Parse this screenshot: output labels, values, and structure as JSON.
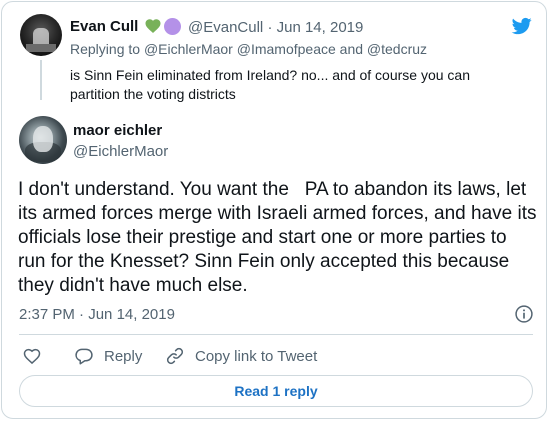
{
  "parent_tweet": {
    "name": "Evan Cull",
    "handle": "@EvanCull",
    "separator": "·",
    "date": "Jun 14, 2019",
    "replying_prefix": "Replying to",
    "mention_1": "@EichlerMaor",
    "mention_2": "@Imamofpeace",
    "conjunction": "and",
    "mention_3": "@tedcruz",
    "text": "is Sinn Fein eliminated from Ireland? no... and of course you can partition the voting districts",
    "emoji_icons": [
      "green-heart-icon",
      "purple-circle-icon"
    ]
  },
  "main_tweet": {
    "name": "maor eichler",
    "handle": "@EichlerMaor",
    "text": "I don't understand. You want the   PA to abandon its laws, let its armed forces merge with Israeli armed forces, and have its officials lose their prestige and start one or more parties to run for the Knesset? Sinn Fein only accepted this because they didn't have much else.",
    "time": "2:37 PM",
    "separator": "·",
    "date": "Jun 14, 2019"
  },
  "actions": {
    "reply_label": "Reply",
    "copy_label": "Copy link to Tweet"
  },
  "read_replies_label": "Read 1 reply",
  "icons": {
    "brand": "twitter-bird-icon",
    "info": "info-icon",
    "like": "heart-icon",
    "reply": "reply-bubble-icon",
    "copy": "link-icon"
  },
  "colors": {
    "brand_blue": "#1d9bf0",
    "link_blue": "#1d72c4",
    "secondary_text": "#536471",
    "border": "#cfd9de",
    "heart_green": "#78b159",
    "circle_purple": "#b491e8"
  }
}
